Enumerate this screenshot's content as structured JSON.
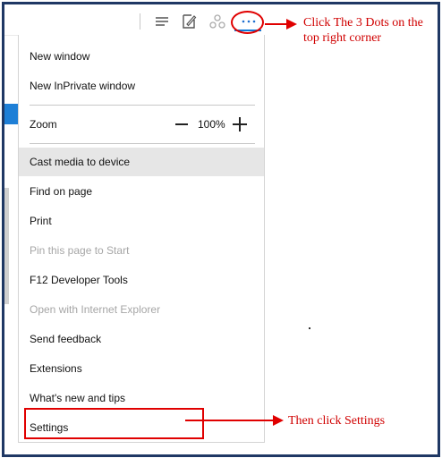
{
  "toolbar": {
    "icons": [
      "hub-icon",
      "web-note-icon",
      "share-icon",
      "more-dots-icon"
    ],
    "more_label": "···"
  },
  "menu": {
    "items": [
      {
        "label": "New window",
        "disabled": false
      },
      {
        "label": "New InPrivate window",
        "disabled": false
      },
      {
        "label": "Zoom",
        "disabled": false
      },
      {
        "label": "Cast media to device",
        "disabled": false,
        "highlighted": true
      },
      {
        "label": "Find on page",
        "disabled": false
      },
      {
        "label": "Print",
        "disabled": false
      },
      {
        "label": "Pin this page to Start",
        "disabled": true
      },
      {
        "label": "F12 Developer Tools",
        "disabled": false
      },
      {
        "label": "Open with Internet Explorer",
        "disabled": true
      },
      {
        "label": "Send feedback",
        "disabled": false
      },
      {
        "label": "Extensions",
        "disabled": false
      },
      {
        "label": "What's new and tips",
        "disabled": false
      },
      {
        "label": "Settings",
        "disabled": false
      }
    ],
    "zoom": {
      "value": "100%"
    }
  },
  "annotations": {
    "dots_note": "Click The 3 Dots on the top right corner",
    "settings_note": "Then click Settings",
    "color": "#e00000"
  }
}
